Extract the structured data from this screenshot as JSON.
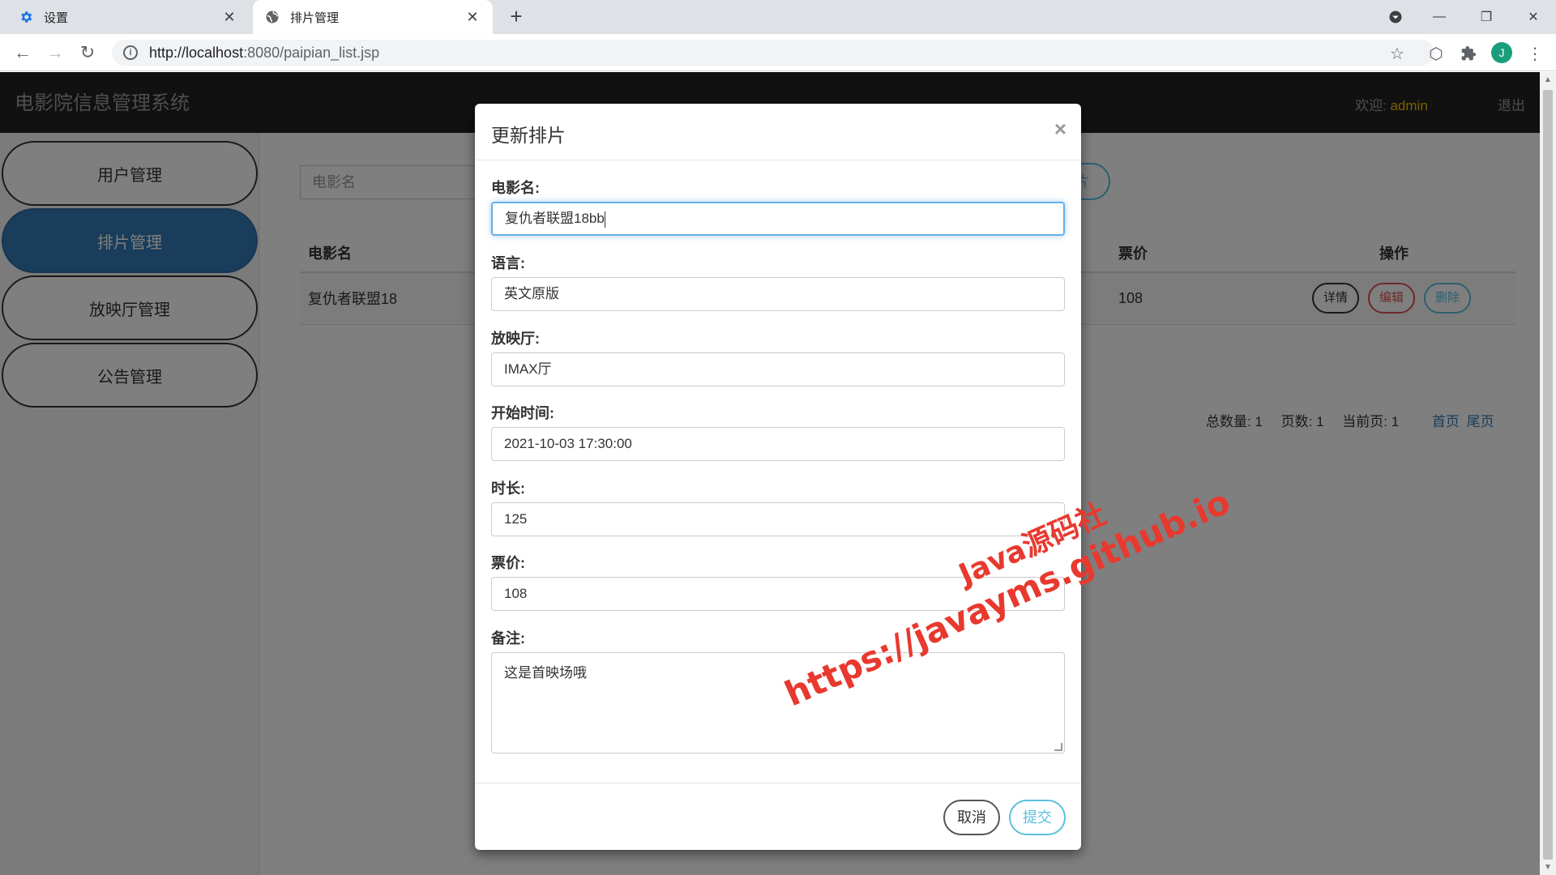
{
  "browser": {
    "tabs": [
      {
        "title": "设置",
        "icon": "gear-icon",
        "active": false
      },
      {
        "title": "排片管理",
        "icon": "globe-icon",
        "active": true
      }
    ],
    "url_host": "http://localhost",
    "url_rest": ":8080/paipian_list.jsp",
    "profile_initial": "J"
  },
  "app": {
    "title": "电影院信息管理系统",
    "welcome_label": "欢迎:",
    "username": "admin",
    "logout": "退出"
  },
  "sidebar": {
    "items": [
      {
        "label": "用户管理",
        "active": false
      },
      {
        "label": "排片管理",
        "active": true
      },
      {
        "label": "放映厅管理",
        "active": false
      },
      {
        "label": "公告管理",
        "active": false
      }
    ]
  },
  "main": {
    "search_placeholder": "电影名",
    "add_button_partial": "片",
    "table": {
      "headers": {
        "movie": "电影名",
        "price": "票价",
        "ops": "操作"
      },
      "rows": [
        {
          "movie": "复仇者联盟18",
          "price": "108",
          "detail": "详情",
          "edit": "编辑",
          "delete": "删除"
        }
      ]
    },
    "pager": {
      "total": "总数量: 1",
      "pages": "页数: 1",
      "current": "当前页: 1",
      "first": "首页",
      "last": "尾页"
    }
  },
  "modal": {
    "title": "更新排片",
    "close": "×",
    "fields": {
      "movie": {
        "label": "电影名:",
        "value": "复仇者联盟18bb"
      },
      "language": {
        "label": "语言:",
        "value": "英文原版"
      },
      "hall": {
        "label": "放映厅:",
        "value": "IMAX厅"
      },
      "start_time": {
        "label": "开始时间:",
        "value": "2021-10-03 17:30:00"
      },
      "duration": {
        "label": "时长:",
        "value": "125"
      },
      "price": {
        "label": "票价:",
        "value": "108"
      },
      "note": {
        "label": "备注:",
        "value": "这是首映场哦"
      }
    },
    "cancel": "取消",
    "submit": "提交"
  },
  "watermark": {
    "line1": "Java源码社",
    "line2": "https://javayms.github.io"
  },
  "colors": {
    "primary": "#337ab7",
    "info": "#5bc0de",
    "danger": "#d9534f",
    "username": "#f0c000",
    "watermark": "#e8392f"
  }
}
